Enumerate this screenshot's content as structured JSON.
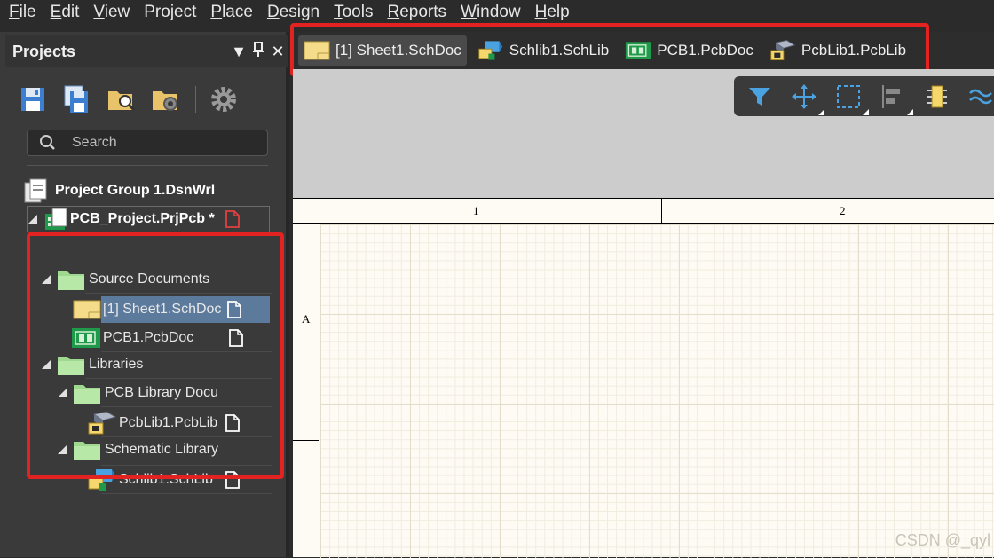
{
  "menu": [
    {
      "label": "File",
      "ul": "F",
      "rest": "ile"
    },
    {
      "label": "Edit",
      "ul": "E",
      "rest": "dit"
    },
    {
      "label": "View",
      "ul": "V",
      "rest": "iew"
    },
    {
      "label": "Project",
      "ul": "",
      "rest": "Project"
    },
    {
      "label": "Place",
      "ul": "P",
      "rest": "lace"
    },
    {
      "label": "Design",
      "ul": "D",
      "rest": "esign"
    },
    {
      "label": "Tools",
      "ul": "T",
      "rest": "ools"
    },
    {
      "label": "Reports",
      "ul": "R",
      "rest": "eports"
    },
    {
      "label": "Window",
      "ul": "W",
      "rest": "indow"
    },
    {
      "label": "Help",
      "ul": "H",
      "rest": "elp"
    }
  ],
  "panel": {
    "title": "Projects",
    "search_placeholder": "Search",
    "tree": {
      "group": "Project Group 1.DsnWrl",
      "project": "PCB_Project.PrjPcb *",
      "source_docs": "Source Documents",
      "sheet": "[1] Sheet1.SchDoc",
      "pcb": "PCB1.PcbDoc",
      "libraries": "Libraries",
      "pcb_lib_folder": "PCB Library Docu",
      "pcblib": "PcbLib1.PcbLib",
      "sch_lib_folder": "Schematic Library",
      "schlib": "Schlib1.SchLib"
    }
  },
  "tabs": [
    {
      "label": "[1] Sheet1.SchDoc",
      "icon": "schdoc-icon",
      "active": true
    },
    {
      "label": "Schlib1.SchLib",
      "icon": "schlib-icon",
      "active": false
    },
    {
      "label": "PCB1.PcbDoc",
      "icon": "pcbdoc-icon",
      "active": false
    },
    {
      "label": "PcbLib1.PcbLib",
      "icon": "pcblib-icon",
      "active": false
    }
  ],
  "sheet": {
    "col1": "1",
    "col2": "2",
    "rowA": "A"
  },
  "watermark": "CSDN @_qyl",
  "colors": {
    "highlight": "#e32222",
    "selection": "#5b7a9c",
    "accent_blue": "#4aa3e0"
  }
}
